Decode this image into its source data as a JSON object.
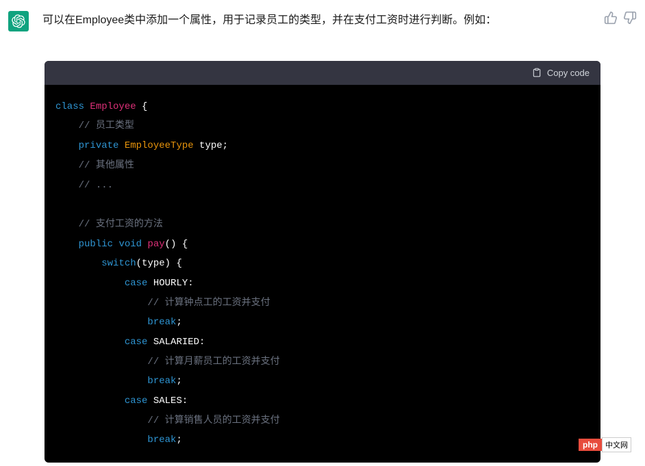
{
  "message": {
    "text": "可以在Employee类中添加一个属性，用于记录员工的类型，并在支付工资时进行判断。例如："
  },
  "codeBlock": {
    "copyLabel": "Copy code",
    "tokens": {
      "class": "class",
      "className": "Employee",
      "openBrace": " {",
      "comment1": "// 员工类型",
      "private": "private",
      "employeeType": "EmployeeType",
      "typeVar": " type;",
      "comment2": "// 其他属性",
      "comment3": "// ...",
      "comment4": "// 支付工资的方法",
      "public": "public",
      "void": "void",
      "pay": "pay",
      "payParens": "() {",
      "switch": "switch",
      "switchExpr": "(type) {",
      "case": "case",
      "hourly": " HOURLY:",
      "comment5": "// 计算钟点工的工资并支付",
      "break": "break",
      "semicolon": ";",
      "salaried": " SALARIED:",
      "comment6": "// 计算月薪员工的工资并支付",
      "sales": " SALES:",
      "comment7": "// 计算销售人员的工资并支付"
    }
  },
  "badge": {
    "php": "php",
    "cn": "中文网"
  }
}
